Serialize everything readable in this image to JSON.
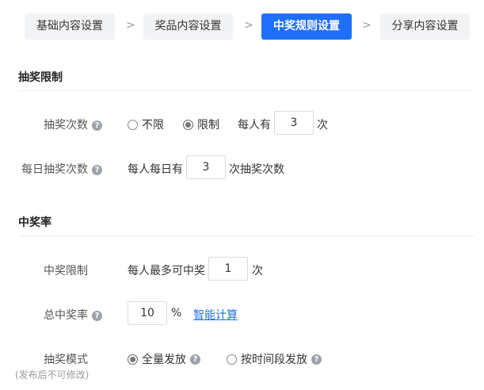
{
  "steps": [
    {
      "label": "基础内容设置",
      "active": false
    },
    {
      "label": "奖品内容设置",
      "active": false
    },
    {
      "label": "中奖规则设置",
      "active": true
    },
    {
      "label": "分享内容设置",
      "active": false
    }
  ],
  "step_separator": ">",
  "section_draw_limit": {
    "title": "抽奖限制",
    "draw_count": {
      "label": "抽奖次数",
      "option_unlimited": "不限",
      "option_limited": "限制",
      "selected": "限制",
      "prefix": "每人有",
      "value": "3",
      "suffix": "次"
    },
    "daily_draw_count": {
      "label": "每日抽奖次数",
      "prefix": "每人每日有",
      "value": "3",
      "suffix": "次抽奖次数"
    }
  },
  "section_win_rate": {
    "title": "中奖率",
    "win_limit": {
      "label": "中奖限制",
      "prefix": "每人最多可中奖",
      "value": "1",
      "suffix": "次"
    },
    "total_rate": {
      "label": "总中奖率",
      "value": "10",
      "unit": "%",
      "smart_calc_link": "智能计算"
    },
    "draw_mode": {
      "label": "抽奖模式",
      "note": "(发布后不可修改)",
      "option_full": "全量发放",
      "option_timed": "按时间段发放",
      "selected": "全量发放"
    }
  },
  "icons": {
    "help": "question-circle-icon",
    "arrow": "chevron-right-icon"
  },
  "colors": {
    "accent": "#1f6fff",
    "step_bg": "#f2f3f5"
  }
}
